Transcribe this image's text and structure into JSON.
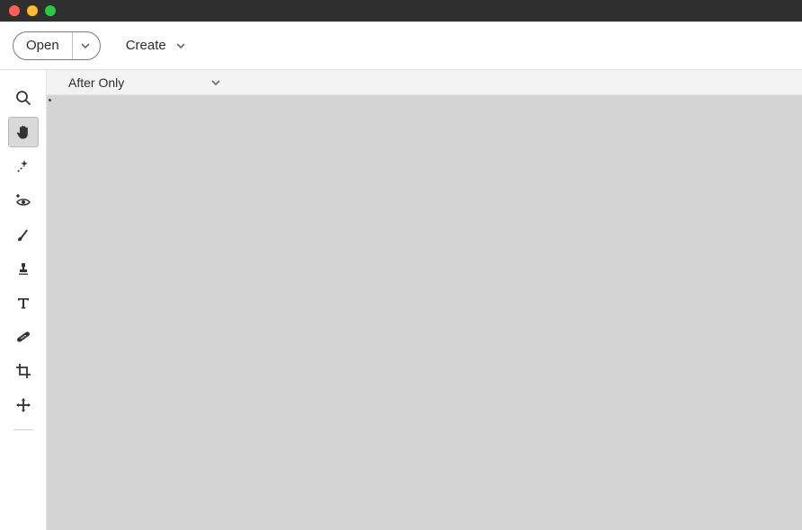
{
  "titlebar": {},
  "menubar": {
    "open_label": "Open",
    "create_label": "Create"
  },
  "viewbar": {
    "mode_label": "After Only"
  },
  "toolbar": {
    "tools": [
      {
        "name": "zoom"
      },
      {
        "name": "hand"
      },
      {
        "name": "quick-select"
      },
      {
        "name": "red-eye"
      },
      {
        "name": "brush"
      },
      {
        "name": "stamp"
      },
      {
        "name": "type"
      },
      {
        "name": "healing"
      },
      {
        "name": "crop"
      },
      {
        "name": "move"
      }
    ],
    "active_tool": "hand"
  }
}
